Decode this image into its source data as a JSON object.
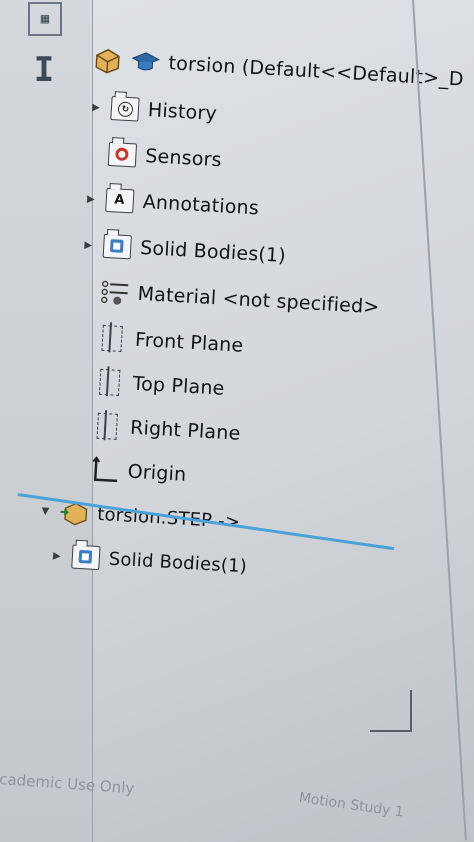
{
  "tree": {
    "part_name": "torsion  (Default<<Default>_D",
    "items": [
      {
        "label": "History",
        "icon": "history-icon",
        "expandable": true
      },
      {
        "label": "Sensors",
        "icon": "sensors-icon",
        "expandable": false
      },
      {
        "label": "Annotations",
        "icon": "annotations-icon",
        "expandable": true
      },
      {
        "label": "Solid Bodies(1)",
        "icon": "solid-bodies-icon",
        "expandable": true
      },
      {
        "label": "Material <not specified>",
        "icon": "material-icon",
        "expandable": false
      },
      {
        "label": "Front Plane",
        "icon": "plane-icon",
        "expandable": false
      },
      {
        "label": "Top Plane",
        "icon": "plane-icon",
        "expandable": false
      },
      {
        "label": "Right Plane",
        "icon": "plane-icon",
        "expandable": false
      },
      {
        "label": "Origin",
        "icon": "origin-icon",
        "expandable": false
      },
      {
        "label": "torsion.STEP ->",
        "icon": "imported-part-icon",
        "expandable": true,
        "expanded": true
      },
      {
        "label": "Solid Bodies(1)",
        "icon": "solid-bodies-icon",
        "expandable": true
      }
    ]
  },
  "footer": {
    "license_text": "cademic Use Only",
    "study_tab": "Motion Study 1"
  },
  "colors": {
    "selection_line": "#4aa3d8",
    "text": "#101418",
    "background": "#d6d9dd"
  }
}
